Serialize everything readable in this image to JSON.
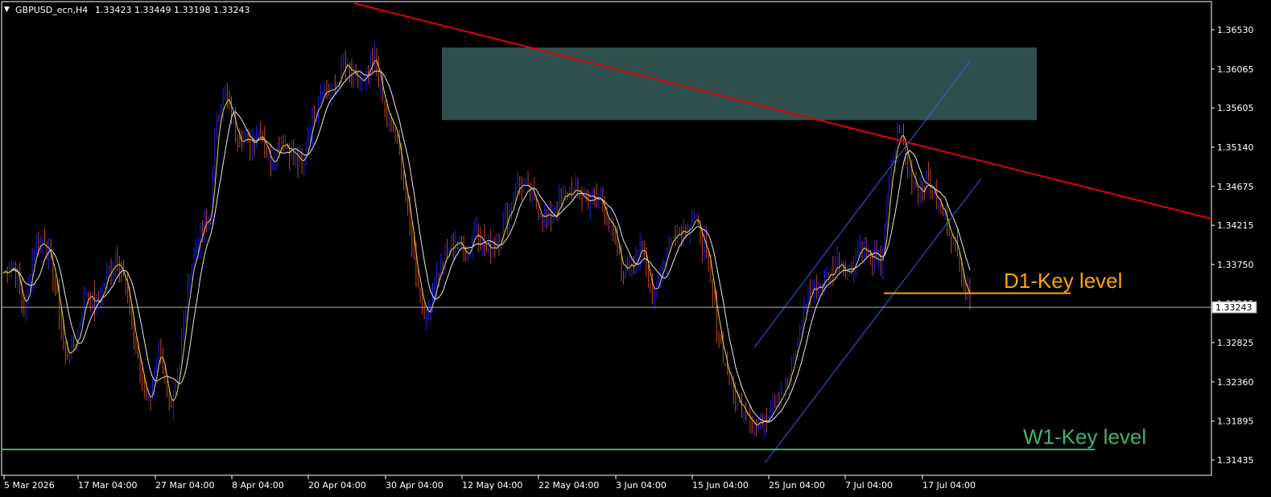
{
  "header": {
    "symbol": "GBPUSD_ecn,H4",
    "ohlc": "1.33423 1.33449 1.33198 1.33243"
  },
  "current_price_label": "1.33243",
  "annotations": {
    "d1_label": "D1-Key level",
    "w1_label": "W1-Key level"
  },
  "chart_data": {
    "type": "candlestick",
    "symbol": "GBPUSD_ecn",
    "timeframe": "H4",
    "y_ticks": [
      "1.36530",
      "1.36065",
      "1.35605",
      "1.35140",
      "1.34675",
      "1.34215",
      "1.33750",
      "1.33285",
      "1.32825",
      "1.32360",
      "1.31895",
      "1.31435"
    ],
    "y_tick_values": [
      1.3653,
      1.36065,
      1.35605,
      1.3514,
      1.34675,
      1.34215,
      1.3375,
      1.33285,
      1.32825,
      1.3236,
      1.31895,
      1.31435
    ],
    "x_ticks": [
      "5 Mar 2026",
      "17 Mar 04:00",
      "27 Mar 04:00",
      "8 Apr 04:00",
      "20 Apr 04:00",
      "30 Apr 04:00",
      "12 May 04:00",
      "22 May 04:00",
      "3 Jun 04:00",
      "15 Jun 04:00",
      "25 Jun 04:00",
      "7 Jul 04:00",
      "17 Jul 04:00"
    ],
    "ylim": [
      1.3125,
      1.3681
    ],
    "bar_count": 240,
    "close_path": [
      [
        0,
        1.3365
      ],
      [
        5,
        1.3378
      ],
      [
        10,
        1.3318
      ],
      [
        15,
        1.3395
      ],
      [
        20,
        1.3405
      ],
      [
        25,
        1.3352
      ],
      [
        30,
        1.3265
      ],
      [
        35,
        1.3282
      ],
      [
        40,
        1.3345
      ],
      [
        45,
        1.3325
      ],
      [
        50,
        1.3362
      ],
      [
        55,
        1.3388
      ],
      [
        60,
        1.3335
      ],
      [
        65,
        1.3258
      ],
      [
        70,
        1.3212
      ],
      [
        75,
        1.3268
      ],
      [
        80,
        1.3205
      ],
      [
        85,
        1.3258
      ],
      [
        90,
        1.3368
      ],
      [
        95,
        1.3412
      ],
      [
        100,
        1.3435
      ],
      [
        103,
        1.3555
      ],
      [
        107,
        1.3572
      ],
      [
        112,
        1.3535
      ],
      [
        118,
        1.3518
      ],
      [
        124,
        1.3535
      ],
      [
        129,
        1.3495
      ],
      [
        134,
        1.3525
      ],
      [
        139,
        1.351
      ],
      [
        144,
        1.3488
      ],
      [
        149,
        1.3552
      ],
      [
        154,
        1.3585
      ],
      [
        159,
        1.3578
      ],
      [
        164,
        1.361
      ],
      [
        169,
        1.3595
      ],
      [
        174,
        1.3588
      ],
      [
        179,
        1.362
      ],
      [
        184,
        1.3555
      ],
      [
        189,
        1.353
      ],
      [
        194,
        1.3455
      ],
      [
        199,
        1.3365
      ],
      [
        204,
        1.331
      ],
      [
        208,
        1.3355
      ],
      [
        213,
        1.3382
      ],
      [
        218,
        1.3405
      ],
      [
        223,
        1.3388
      ],
      [
        228,
        1.342
      ],
      [
        233,
        1.3392
      ],
      [
        238,
        1.3402
      ],
      [
        243,
        1.3432
      ],
      [
        248,
        1.3472
      ],
      [
        253,
        1.3462
      ],
      [
        258,
        1.344
      ],
      [
        263,
        1.3428
      ],
      [
        268,
        1.3445
      ],
      [
        273,
        1.3462
      ],
      [
        278,
        1.3458
      ],
      [
        283,
        1.345
      ],
      [
        288,
        1.3452
      ],
      [
        293,
        1.342
      ],
      [
        298,
        1.3368
      ],
      [
        303,
        1.338
      ],
      [
        308,
        1.3392
      ],
      [
        313,
        1.3342
      ],
      [
        318,
        1.3375
      ],
      [
        323,
        1.3415
      ],
      [
        328,
        1.3418
      ],
      [
        333,
        1.3428
      ],
      [
        338,
        1.3398
      ],
      [
        343,
        1.332
      ],
      [
        348,
        1.3255
      ],
      [
        353,
        1.3215
      ],
      [
        358,
        1.3205
      ],
      [
        363,
        1.3182
      ],
      [
        368,
        1.3198
      ],
      [
        373,
        1.3218
      ],
      [
        378,
        1.3232
      ],
      [
        383,
        1.3282
      ],
      [
        388,
        1.3342
      ],
      [
        393,
        1.335
      ],
      [
        398,
        1.3362
      ],
      [
        403,
        1.338
      ],
      [
        408,
        1.3365
      ],
      [
        413,
        1.34
      ],
      [
        418,
        1.3382
      ],
      [
        423,
        1.3372
      ],
      [
        428,
        1.3488
      ],
      [
        432,
        1.3538
      ],
      [
        436,
        1.3492
      ],
      [
        441,
        1.3465
      ],
      [
        446,
        1.3472
      ],
      [
        451,
        1.3445
      ],
      [
        456,
        1.3418
      ],
      [
        461,
        1.3378
      ],
      [
        466,
        1.3324
      ]
    ]
  },
  "overlays": {
    "resistance_zone_top": 1.3632,
    "resistance_zone_bottom": 1.3546,
    "d1_key_level": 1.3341,
    "w1_key_level": 1.3156,
    "current_price": 1.33243
  },
  "colors": {
    "background": "#000000",
    "foreground": "#ffffff",
    "bull_candle": "#2222ee",
    "bear_candle": "#c4452a",
    "ma_fast": "#e8d640",
    "ma_slow": "#e8e8e8",
    "trendline": "#e00000",
    "channel": "#3860e8",
    "zone_fill": "#2f4f4f",
    "d1_level": "#ffa500",
    "w1_level": "#3cb371",
    "price_line": "#aab4be"
  }
}
